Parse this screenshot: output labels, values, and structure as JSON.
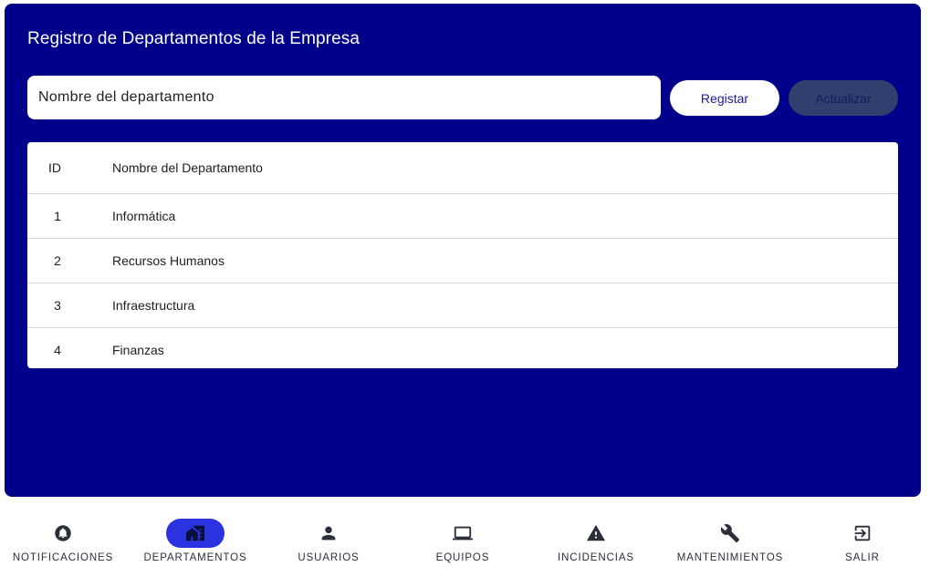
{
  "page": {
    "title": "Registro de Departamentos de la Empresa"
  },
  "form": {
    "name_placeholder": "Nombre del departamento",
    "register_label": "Registar",
    "update_label": "Actualizar"
  },
  "table": {
    "headers": {
      "id": "ID",
      "name": "Nombre del Departamento"
    },
    "rows": [
      {
        "id": "1",
        "name": "Informática"
      },
      {
        "id": "2",
        "name": "Recursos Humanos"
      },
      {
        "id": "3",
        "name": "Infraestructura"
      },
      {
        "id": "4",
        "name": "Finanzas"
      }
    ]
  },
  "nav": {
    "items": [
      {
        "label": "NOTIFICACIONES",
        "icon": "bell-icon",
        "active": false
      },
      {
        "label": "DEPARTAMENTOS",
        "icon": "home-work-icon",
        "active": true
      },
      {
        "label": "USUARIOS",
        "icon": "person-icon",
        "active": false
      },
      {
        "label": "EQUIPOS",
        "icon": "laptop-icon",
        "active": false
      },
      {
        "label": "INCIDENCIAS",
        "icon": "warning-icon",
        "active": false
      },
      {
        "label": "MANTENIMIENTOS",
        "icon": "wrench-icon",
        "active": false
      },
      {
        "label": "SALIR",
        "icon": "exit-icon",
        "active": false
      }
    ]
  },
  "colors": {
    "panel_bg": "#00008b",
    "active_nav_pill": "#2b33e0",
    "update_button_bg": "#2f3f6e"
  }
}
